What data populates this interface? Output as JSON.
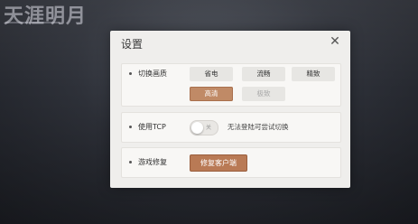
{
  "background": {
    "logo_text": "天涯明月"
  },
  "dialog": {
    "title": "设置",
    "close_symbol": "✕"
  },
  "quality": {
    "label": "切换画质",
    "options": [
      "省电",
      "流畅",
      "精致",
      "高清",
      "极致"
    ],
    "selected": "高清",
    "disabled": [
      "极致"
    ]
  },
  "tcp": {
    "label": "使用TCP",
    "toggle_text": "关",
    "enabled": false,
    "hint": "无法登陆可尝试切换"
  },
  "repair": {
    "label": "游戏修复",
    "button_label": "修复客户端"
  },
  "colors": {
    "accent": "#c08a66",
    "dialog_bg": "#efeeec",
    "panel_bg": "#f8f7f5"
  }
}
